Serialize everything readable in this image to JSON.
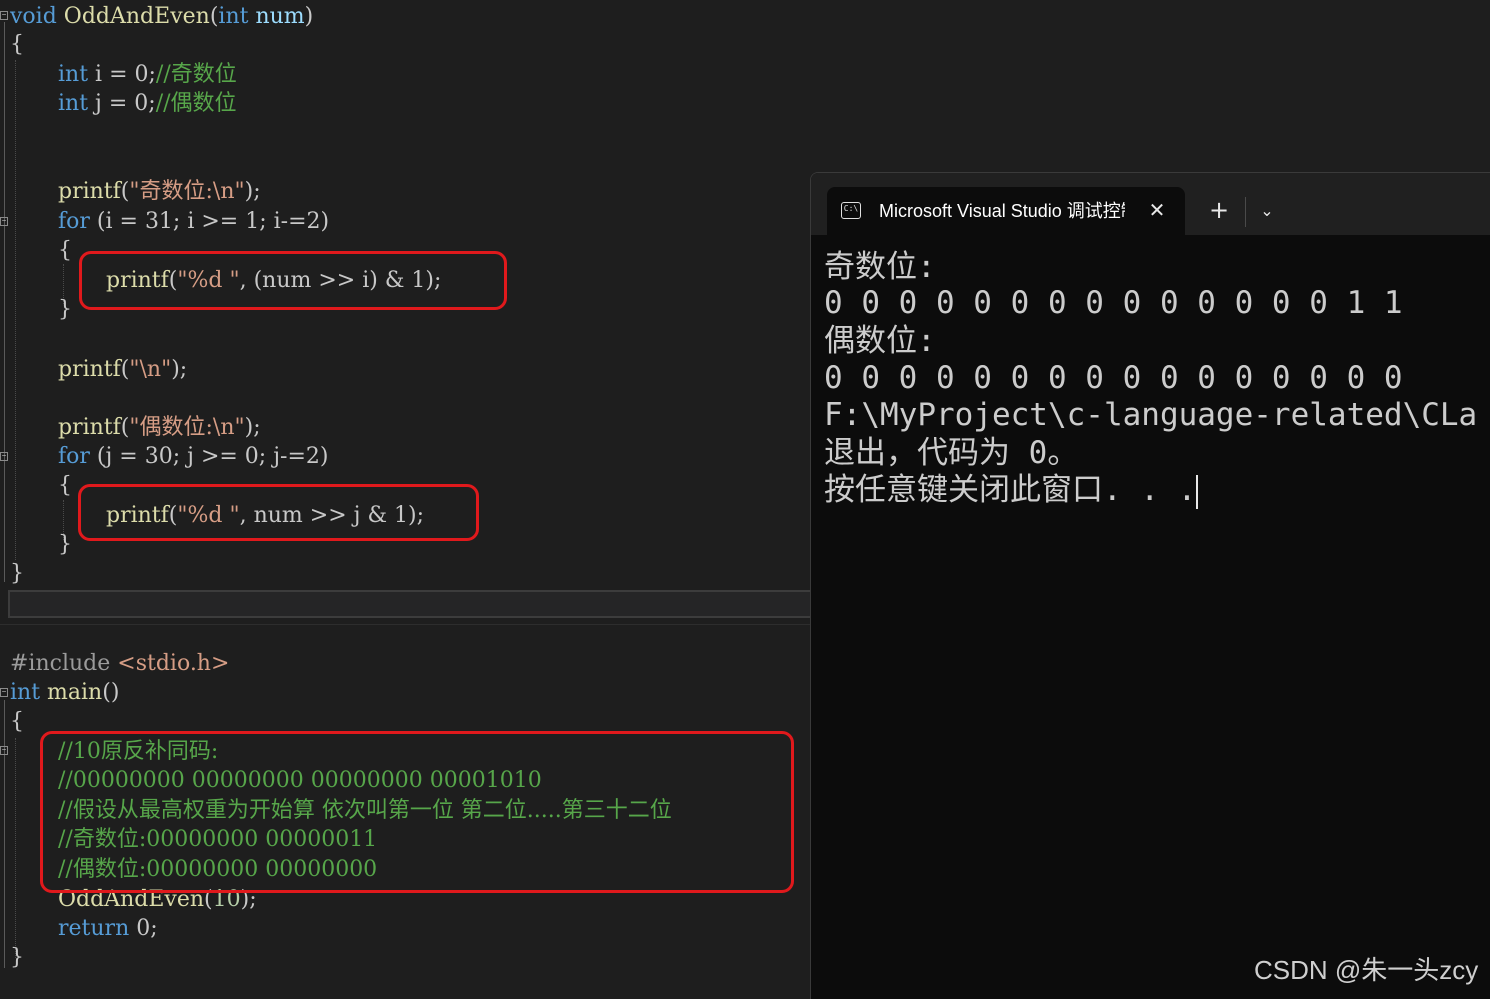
{
  "editor": {
    "func_decl": {
      "kw": "void",
      "name": "OddAndEven",
      "open": "(",
      "ptype": "int",
      "pname": " num",
      "close": ")"
    },
    "brace_open": "{",
    "decl_i": {
      "kw": "int",
      "rest": " i = 0;",
      "comment": "//奇数位"
    },
    "decl_j": {
      "kw": "int",
      "rest": " j = 0;",
      "comment": "//偶数位"
    },
    "printf_odd": {
      "fn": "printf",
      "open": "(",
      "str": "\"奇数位:\\n\"",
      "close": ");"
    },
    "for_i": {
      "kw": "for",
      "rest": " (i = 31; i >= 1; i-=2)"
    },
    "brace_i_open": "{",
    "printf_i": {
      "fn": "printf",
      "open": "(",
      "str": "\"%d \"",
      "rest": ", (num >> i) & 1);"
    },
    "brace_i_close": "}",
    "printf_nl": {
      "fn": "printf",
      "open": "(",
      "str": "\"\\n\"",
      "close": ");"
    },
    "printf_even": {
      "fn": "printf",
      "open": "(",
      "str": "\"偶数位:\\n\"",
      "close": ");"
    },
    "for_j": {
      "kw": "for",
      "rest": " (j = 30; j >= 0; j-=2)"
    },
    "brace_j_open": "{",
    "printf_j": {
      "fn": "printf",
      "open": "(",
      "str": "\"%d \"",
      "rest": ", num >> j & 1);"
    },
    "brace_j_close": "}",
    "brace_close": "}",
    "include": {
      "pp": "#include",
      "header": " <stdio.h>"
    },
    "main_decl": {
      "kw": "int",
      "name": " main",
      "rest": "()"
    },
    "main_brace_open": "{",
    "comments": [
      "//10原反补同码:",
      "//00000000 00000000 00000000 00001010",
      "//假设从最高权重为开始算 依次叫第一位 第二位.....第三十二位",
      "//奇数位:00000000 00000011",
      "//偶数位:00000000 00000000"
    ],
    "call": {
      "fn": "OddAndEven",
      "open": "(",
      "arg": "10",
      "close": ");"
    },
    "ret": {
      "kw": "return",
      "rest": " 0;"
    },
    "main_brace_close": "}"
  },
  "terminal": {
    "tab_title": "Microsoft Visual Studio 调试控制台",
    "tab_icon_text": "C:\\",
    "close_glyph": "✕",
    "new_tab_glyph": "+",
    "dropdown_glyph": "⌄",
    "lines": [
      "奇数位:",
      "0 0 0 0 0 0 0 0 0 0 0 0 0 0 1 1",
      "偶数位:",
      "0 0 0 0 0 0 0 0 0 0 0 0 0 0 0 0",
      "F:\\MyProject\\c-language-related\\CLa",
      "退出，代码为 0。",
      "按任意键关闭此窗口. . ."
    ]
  },
  "watermark": "CSDN @朱一头zcy",
  "colors": {
    "highlight": "#e0191c",
    "keyword": "#569cd6",
    "comment": "#57a64a",
    "string": "#d69d85"
  }
}
